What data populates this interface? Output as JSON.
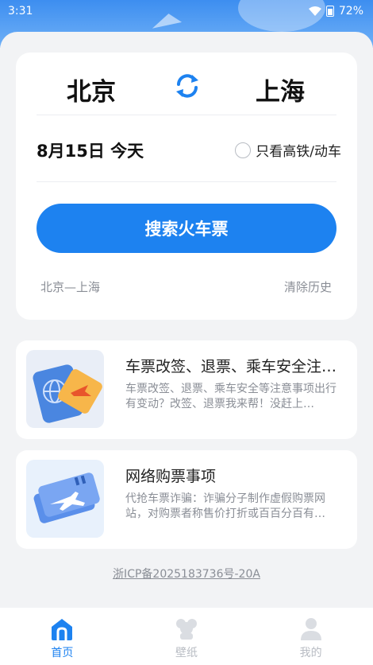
{
  "status_bar": {
    "time": "3:31",
    "battery": "72%"
  },
  "search": {
    "from_city": "北京",
    "to_city": "上海",
    "date": "8月15日 今天",
    "gt_only_label": "只看高铁/动车",
    "search_button": "搜索火车票",
    "history_item": "北京—上海",
    "clear_history": "清除历史"
  },
  "articles": [
    {
      "title": "车票改签、退票、乘车安全注意事项",
      "desc": "车票改签、退票、乘车安全等注意事项出行有变动？改签、退票我来帮！没赶上…",
      "icon": "ticket-change-icon"
    },
    {
      "title": "网络购票事项",
      "desc": "代抢车票诈骗：诈骗分子制作虚假购票网站，对购票者称售价打折或百百分百有…",
      "icon": "ticket-plane-icon"
    }
  ],
  "icp": "浙ICP备2025183736号-20A",
  "tabs": [
    {
      "label": "首页",
      "icon": "home-icon",
      "active": true
    },
    {
      "label": "壁纸",
      "icon": "wallpaper-icon",
      "active": false
    },
    {
      "label": "我的",
      "icon": "user-icon",
      "active": false
    }
  ],
  "colors": {
    "accent": "#1d82f0",
    "hero": "#3d8ef0",
    "muted": "#8a8e96",
    "background": "#f2f3f5"
  }
}
